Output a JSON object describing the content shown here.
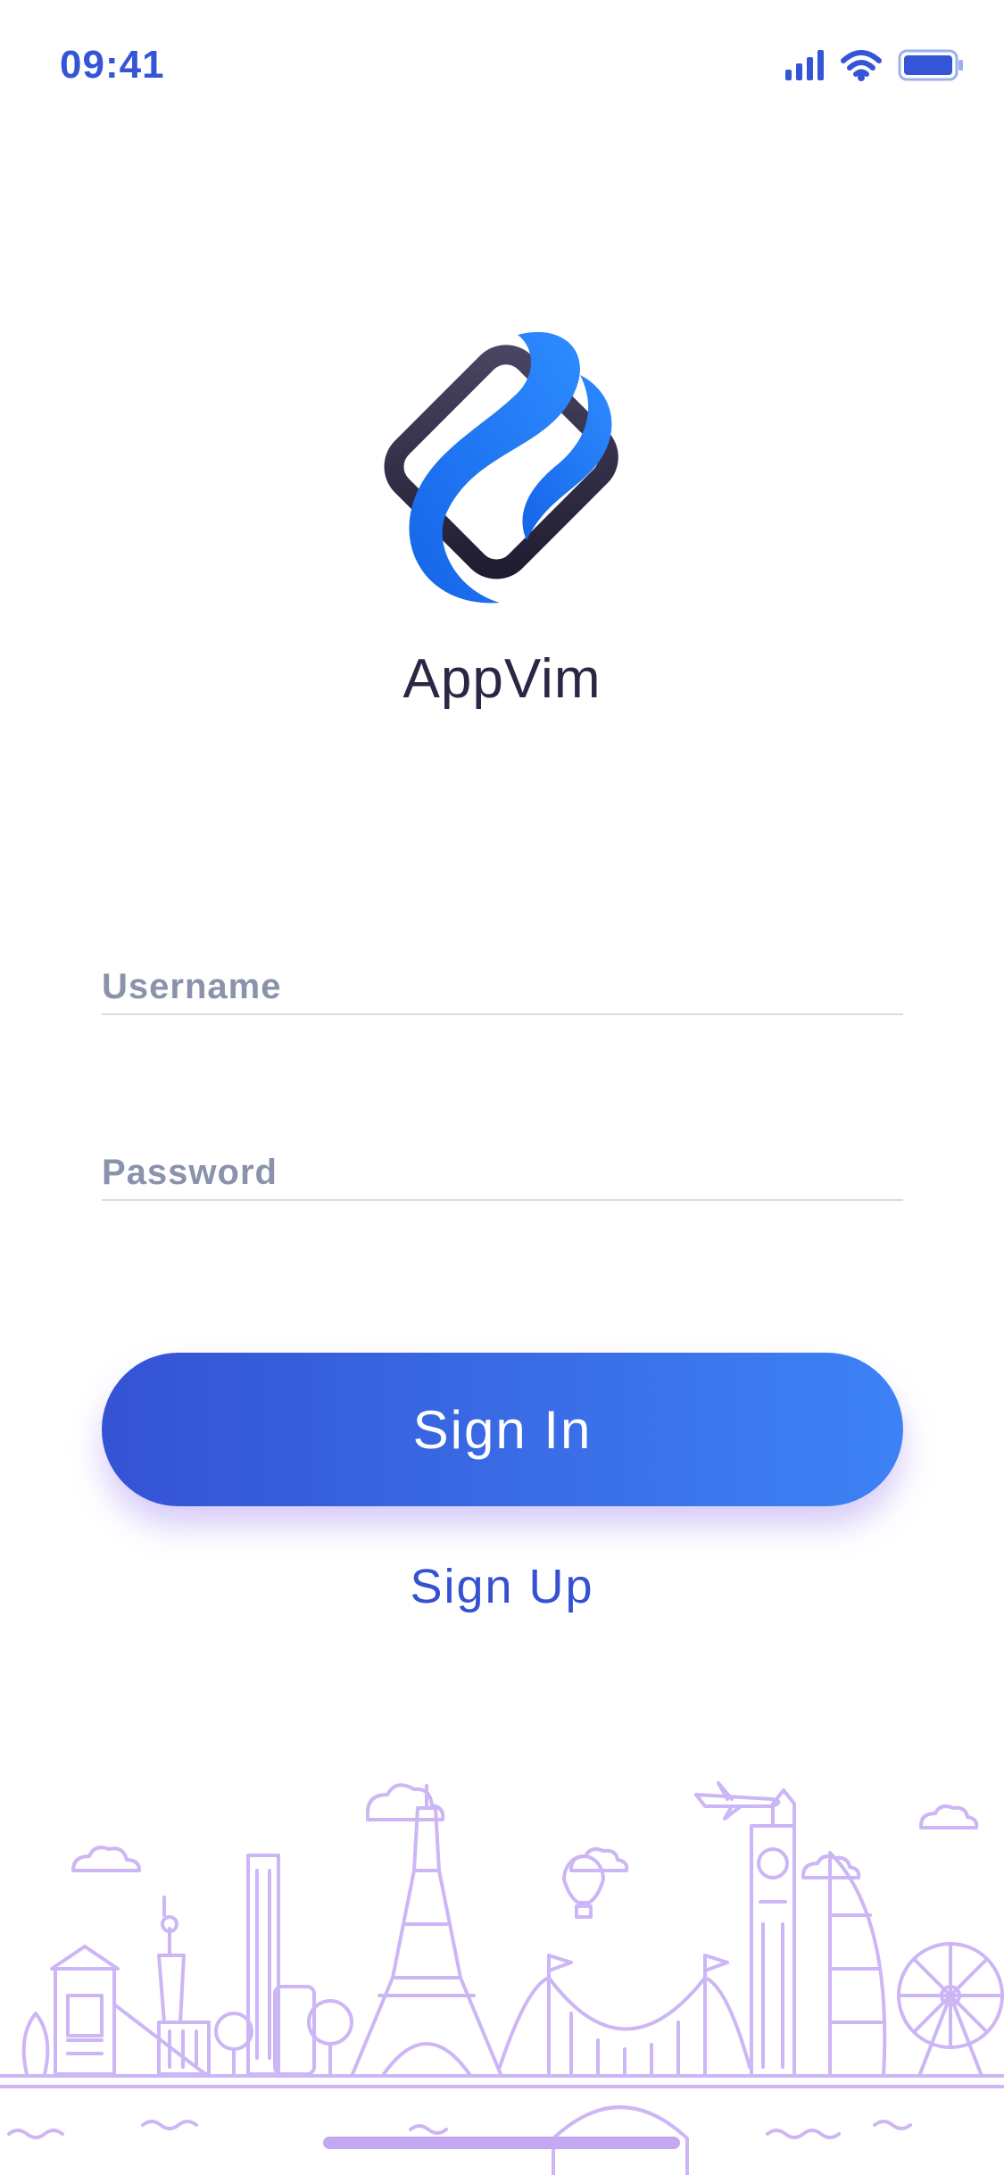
{
  "status_bar": {
    "time": "09:41"
  },
  "brand": {
    "name": "AppVim"
  },
  "login_form": {
    "username": {
      "placeholder": "Username",
      "value": ""
    },
    "password": {
      "placeholder": "Password",
      "value": ""
    },
    "sign_in_label": "Sign In",
    "sign_up_label": "Sign Up"
  },
  "colors": {
    "accent": "#3456D6",
    "button_gradient_start": "#3453D4",
    "button_gradient_end": "#3D82F5",
    "logo_blue": "#1E7BF5",
    "logo_dark": "#2A2640",
    "skyline": "#CDB6F5",
    "placeholder": "#8A93AB"
  },
  "icons": [
    "signal-icon",
    "wifi-icon",
    "battery-icon",
    "appvim-logo",
    "city-skyline-illustration"
  ]
}
